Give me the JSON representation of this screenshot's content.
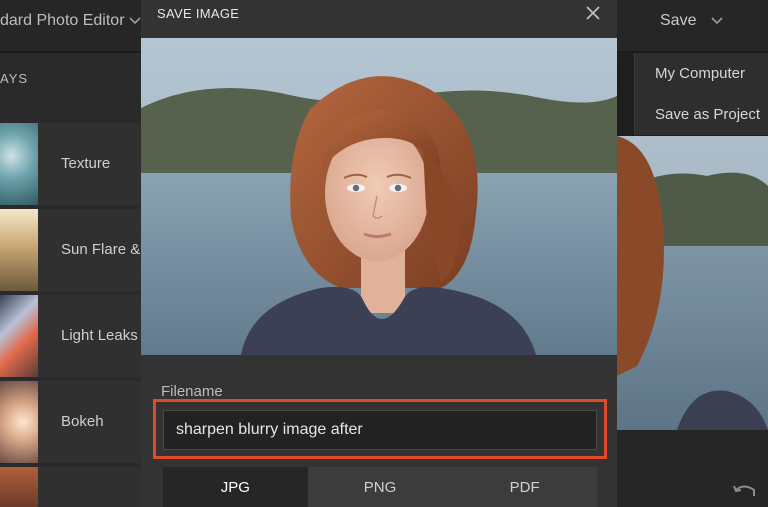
{
  "app": {
    "title": "dard Photo Editor",
    "save_label": "Save"
  },
  "sidebar": {
    "header": "AYS",
    "items": [
      {
        "label": "Texture"
      },
      {
        "label": "Sun Flare &"
      },
      {
        "label": "Light Leaks"
      },
      {
        "label": "Bokeh"
      }
    ]
  },
  "save_menu": {
    "items": [
      {
        "label": "My Computer"
      },
      {
        "label": "Save as Project"
      }
    ]
  },
  "modal": {
    "title": "SAVE IMAGE",
    "filename_label": "Filename",
    "filename_value": "sharpen blurry image after",
    "formats": [
      {
        "label": "JPG",
        "selected": true
      },
      {
        "label": "PNG",
        "selected": false
      },
      {
        "label": "PDF",
        "selected": false
      }
    ]
  },
  "colors": {
    "accent_highlight": "#e0492a",
    "modal_bg": "#333333",
    "app_bg": "#1c1c1c"
  },
  "icons": {
    "close": "close-icon",
    "chevron": "chevron-down-icon",
    "undo": "undo-icon"
  }
}
